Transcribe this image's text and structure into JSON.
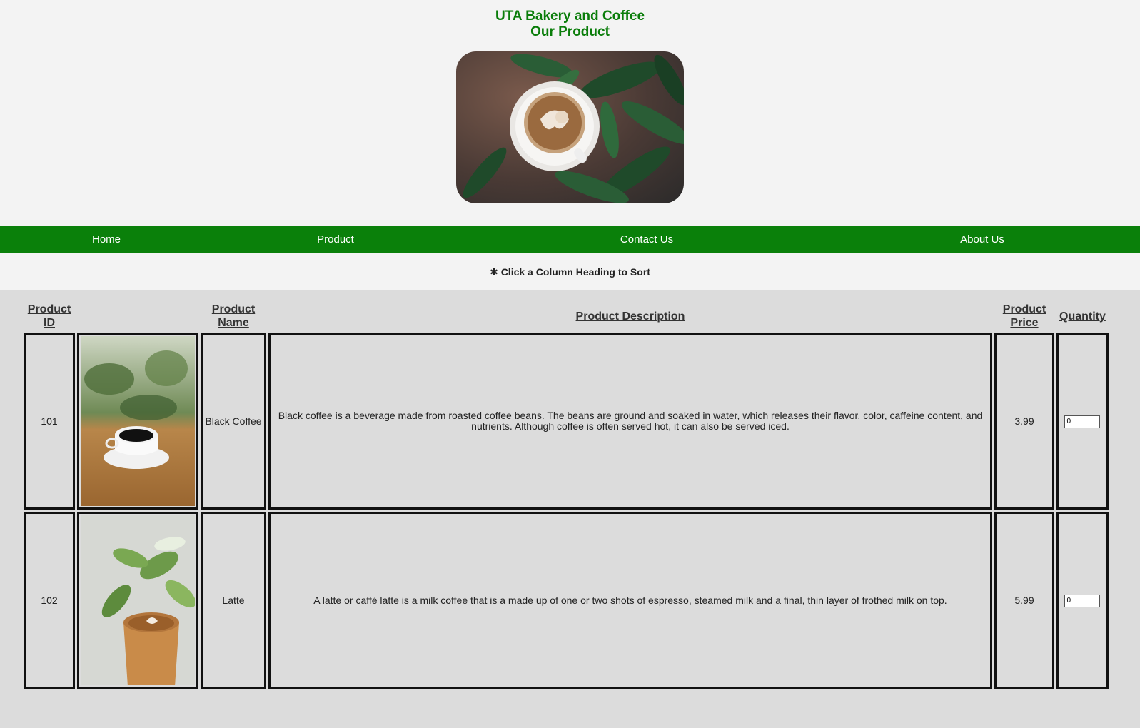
{
  "header": {
    "line1": "UTA Bakery and Coffee",
    "line2": "Our Product"
  },
  "nav": {
    "items": [
      {
        "label": "Home"
      },
      {
        "label": "Product"
      },
      {
        "label": "Contact Us"
      },
      {
        "label": "About Us"
      }
    ]
  },
  "sort_hint": {
    "icon": "asterisk-icon",
    "text": "Click a Column Heading to Sort"
  },
  "table": {
    "headers": {
      "id": "Product ID",
      "name": "Product Name",
      "description": "Product Description",
      "price": "Product Price",
      "quantity": "Quantity"
    },
    "rows": [
      {
        "id": "101",
        "name": "Black Coffee",
        "description": "Black coffee is a beverage made from roasted coffee beans. The beans are ground and soaked in water, which releases their flavor, color, caffeine content, and nutrients. Although coffee is often served hot, it can also be served iced.",
        "price": "3.99",
        "quantity": "0"
      },
      {
        "id": "102",
        "name": "Latte",
        "description": "A latte or caffè latte is a milk coffee that is a made up of one or two shots of espresso, steamed milk and a final, thin layer of frothed milk on top.",
        "price": "5.99",
        "quantity": "0"
      }
    ]
  },
  "colors": {
    "brand_green": "#0a800a",
    "title_green": "#0a7d0a",
    "page_bg": "#f3f3f3",
    "table_bg": "#dcdcdc"
  }
}
